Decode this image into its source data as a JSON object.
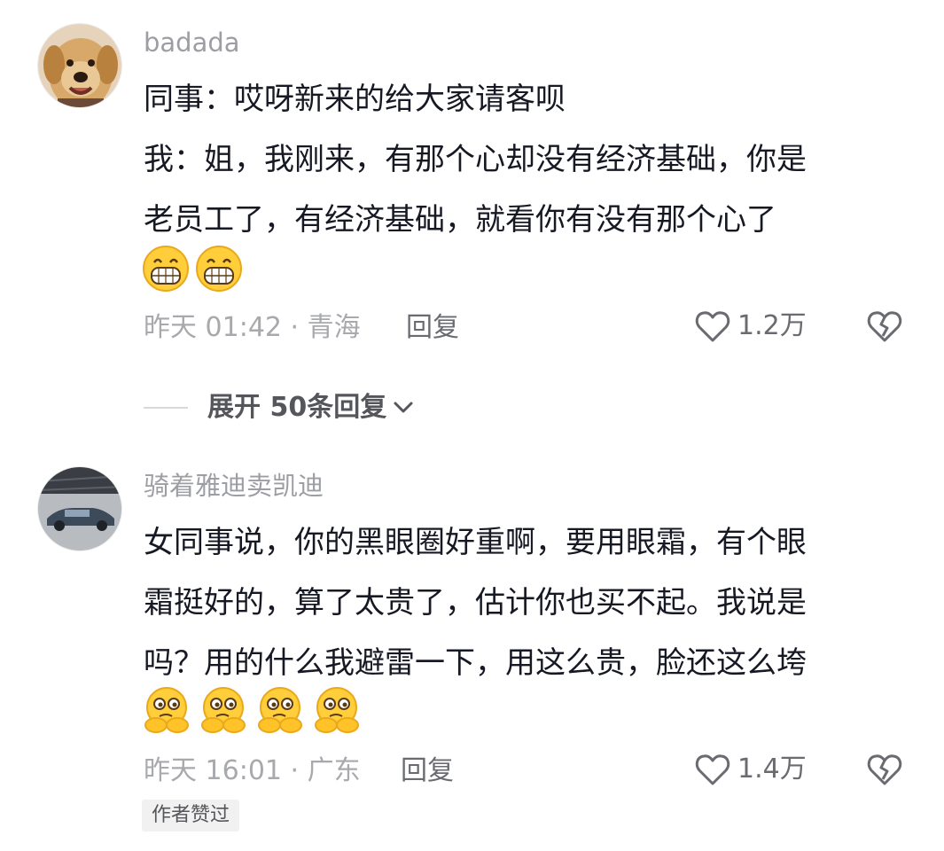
{
  "comments": [
    {
      "username": "badada",
      "lines": [
        "同事：哎呀新来的给大家请客呗",
        "我：姐，我刚来，有那个心却没有经济基础，你是",
        "老员工了，有经济基础，就看你有没有那个心了"
      ],
      "emojis": [
        "grin-emoji",
        "grin-emoji"
      ],
      "time_location": "昨天 01:42 · 青海",
      "reply_label": "回复",
      "like_count": "1.2万",
      "expand_label": "展开 50条回复"
    },
    {
      "username": "骑着雅迪卖凯迪",
      "lines": [
        "女同事说，你的黑眼圈好重啊，要用眼霜，有个眼",
        "霜挺好的，算了太贵了，估计你也买不起。我说是",
        "吗？用的什么我避雷一下，用这么贵，脸还这么垮"
      ],
      "emojis": [
        "thinking-emoji",
        "thinking-emoji",
        "thinking-emoji",
        "thinking-emoji"
      ],
      "time_location": "昨天 16:01 · 广东",
      "reply_label": "回复",
      "like_count": "1.4万",
      "author_badge": "作者赞过"
    }
  ]
}
